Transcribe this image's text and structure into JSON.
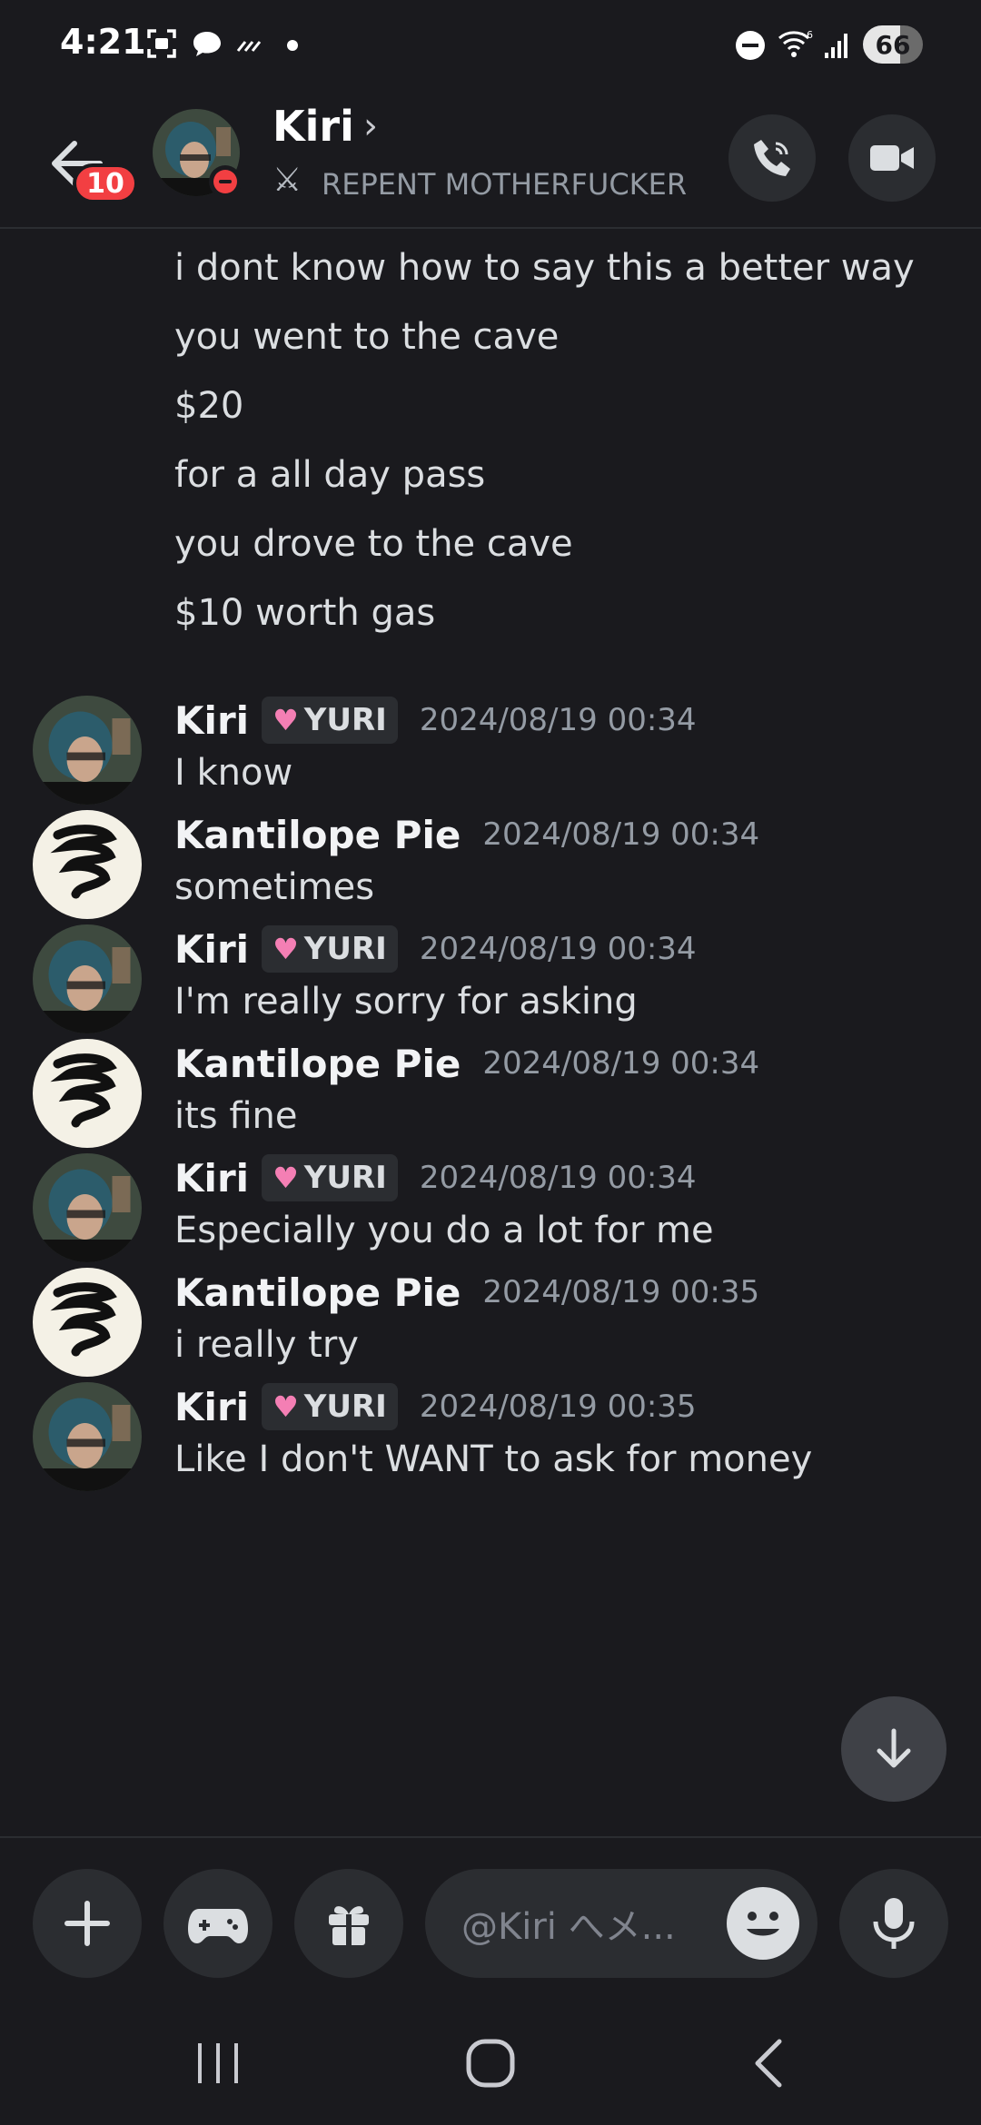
{
  "status_bar": {
    "time": "4:21",
    "battery": "66"
  },
  "header": {
    "back_badge": "10",
    "name": "Kiri",
    "chevron": "›",
    "status_icon": "⚔",
    "status_text": "REPENT MOTHERFUCKER"
  },
  "continued_messages": [
    "i dont know how to say this a better way",
    "you went to the cave",
    "$20",
    "for a all day pass",
    "you drove to the cave",
    "$10 worth gas"
  ],
  "messages": [
    {
      "author": "Kiri",
      "role": "YURI",
      "timestamp": "2024/08/19 00:34",
      "text": "I know"
    },
    {
      "author": "Kantilope Pie",
      "role": "",
      "timestamp": "2024/08/19 00:34",
      "text": "sometimes"
    },
    {
      "author": "Kiri",
      "role": "YURI",
      "timestamp": "2024/08/19 00:34",
      "text": "I'm really sorry for asking"
    },
    {
      "author": "Kantilope Pie",
      "role": "",
      "timestamp": "2024/08/19 00:34",
      "text": "its fine"
    },
    {
      "author": "Kiri",
      "role": "YURI",
      "timestamp": "2024/08/19 00:34",
      "text": "Especially you do a lot for me"
    },
    {
      "author": "Kantilope Pie",
      "role": "",
      "timestamp": "2024/08/19 00:35",
      "text": "i really try"
    },
    {
      "author": "Kiri",
      "role": "YURI",
      "timestamp": "2024/08/19 00:35",
      "text": "Like I don't WANT to ask for money"
    }
  ],
  "composer": {
    "placeholder": "@Kiri へメ..."
  },
  "colors": {
    "background": "#1a1a1e",
    "surface": "#2b2d31",
    "badge_red": "#f23f42",
    "role_heart": "#f47fb4"
  }
}
